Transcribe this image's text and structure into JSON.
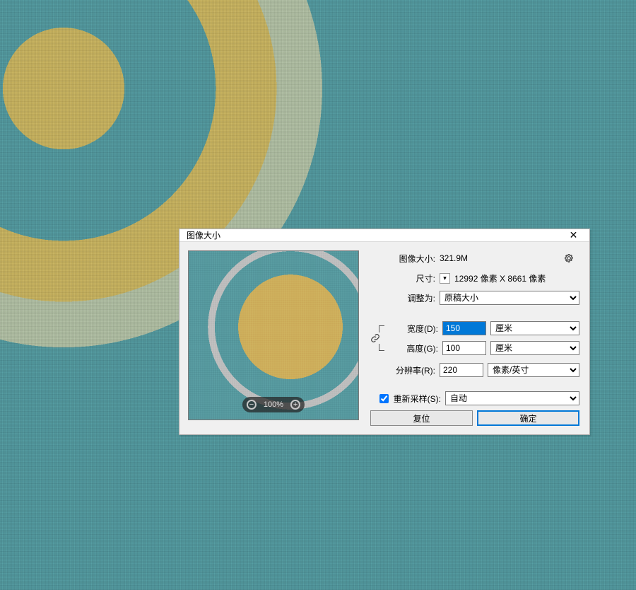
{
  "dialog": {
    "title": "图像大小",
    "close_glyph": "✕",
    "image_size_label": "图像大小:",
    "image_size_value": "321.9M",
    "gear_title": "settings",
    "dim_label": "尺寸:",
    "dim_value": "12992 像素  X  8661 像素",
    "fit_label": "调整为:",
    "fit_value": "原稿大小",
    "width_label": "宽度(D):",
    "width_value": "150",
    "width_unit": "厘米",
    "height_label": "高度(G):",
    "height_value": "100",
    "height_unit": "厘米",
    "res_label": "分辨率(R):",
    "res_value": "220",
    "res_unit": "像素/英寸",
    "resample_label": "重新采样(S):",
    "resample_checked": true,
    "resample_method": "自动",
    "btn_reset": "复位",
    "btn_ok": "确定",
    "preview_zoom": "100%"
  }
}
